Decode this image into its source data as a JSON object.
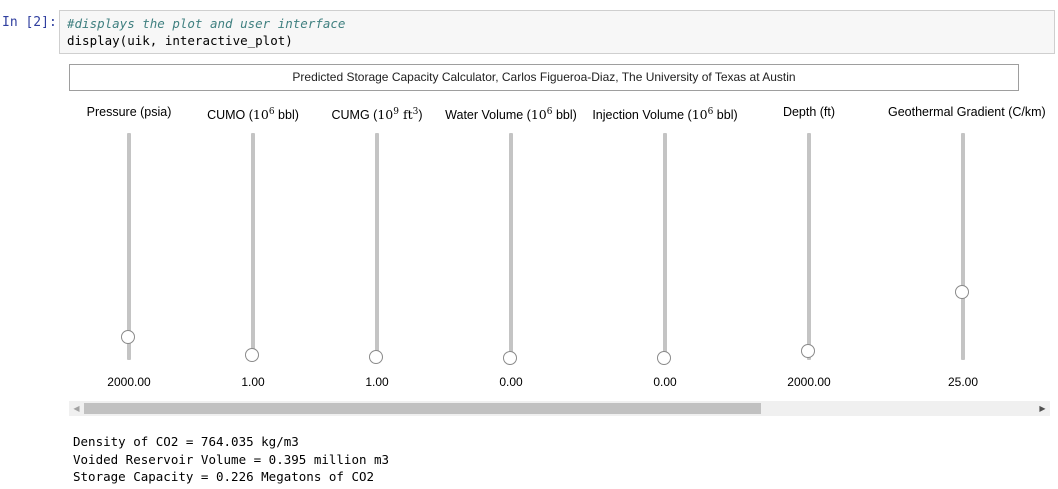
{
  "cell": {
    "prompt": "In [2]:",
    "line1": "#displays the plot and user interface",
    "line2": "display(uik, interactive_plot)"
  },
  "title": "Predicted Storage Capacity Calculator, Carlos Figueroa-Diaz,  The University of Texas at Austin",
  "sliders": [
    {
      "pre": "Pressure (psia)",
      "value": "2000.00",
      "level": 0.1
    },
    {
      "pre": "CUMO (",
      "ser": "10",
      "sup": "6",
      "post": " bbl)",
      "value": "1.00",
      "level": 0.02
    },
    {
      "pre": "CUMG (",
      "ser": "10",
      "sup": "9",
      "post": " ft",
      "sup2": "3",
      "post2": ")",
      "value": "1.00",
      "level": 0.015
    },
    {
      "pre": "Water Volume (",
      "ser": "10",
      "sup": "6",
      "post": " bbl)",
      "value": "0.00",
      "level": 0.01
    },
    {
      "pre": "Injection Volume (",
      "ser": "10",
      "sup": "6",
      "post": " bbl)",
      "value": "0.00",
      "level": 0.01
    },
    {
      "pre": "Depth (ft)",
      "value": "2000.00",
      "level": 0.04
    },
    {
      "pre": "Geothermal Gradient (C/km)",
      "value": "25.00",
      "level": 0.3
    }
  ],
  "scrollbar": {
    "left_arrow": "◀",
    "right_arrow": "▶"
  },
  "output": [
    "Density of CO2 = 764.035 kg/m3",
    "Voided Reservoir Volume = 0.395 million m3",
    "Storage Capacity = 0.226 Megatons of CO2"
  ]
}
